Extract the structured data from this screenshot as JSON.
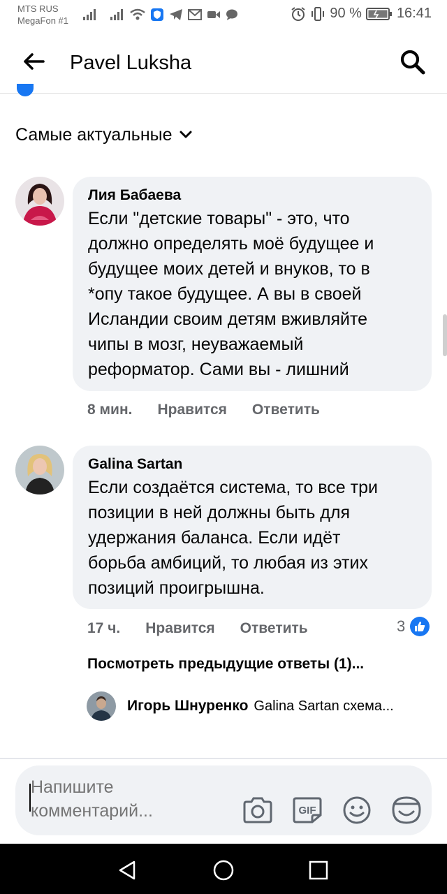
{
  "status_bar": {
    "carrier_1": "MTS RUS",
    "carrier_2": "MegaFon #1",
    "battery_percent": "90 %",
    "time": "16:41"
  },
  "header": {
    "title": "Pavel Luksha"
  },
  "sort": {
    "label": "Самые актуальные"
  },
  "comments": [
    {
      "author": "Лия Бабаева",
      "text_lines": [
        "Если \"детские товары\" - это, что",
        "должно определять моё будущее и",
        "будущее моих детей и внуков, то в",
        "*опу такое будущее. А вы в своей",
        "Исландии своим детям вживляйте",
        "чипы в мозг, неуважаемый",
        "реформатор. Сами вы - лишний"
      ],
      "time": "8 мин.",
      "like": "Нравится",
      "reply": "Ответить"
    },
    {
      "author": "Galina Sartan",
      "text_lines": [
        "Если создаётся система, то все три",
        "позиции в ней должны быть для",
        "удержания баланса. Если идёт",
        "борьба амбиций, то любая из этих",
        "позиций проигрышна."
      ],
      "time": "17 ч.",
      "like": "Нравится",
      "reply": "Ответить",
      "reaction_count": "3",
      "view_previous": "Посмотреть предыдущие ответы (1)...",
      "latest_reply": {
        "author": "Игорь Шнуренко",
        "text": "Galina Sartan схема..."
      }
    }
  ],
  "composer": {
    "placeholder": "Напишите комментарий..."
  },
  "colors": {
    "accent": "#1877f2",
    "bubble": "#f0f2f5",
    "muted": "#65676b"
  },
  "icons": [
    "arrow-left-icon",
    "search-icon",
    "chevron-down-icon",
    "like-icon",
    "camera-icon",
    "gif-icon",
    "emoji-icon",
    "sticker-icon",
    "nav-back-icon",
    "nav-home-icon",
    "nav-recents-icon"
  ]
}
